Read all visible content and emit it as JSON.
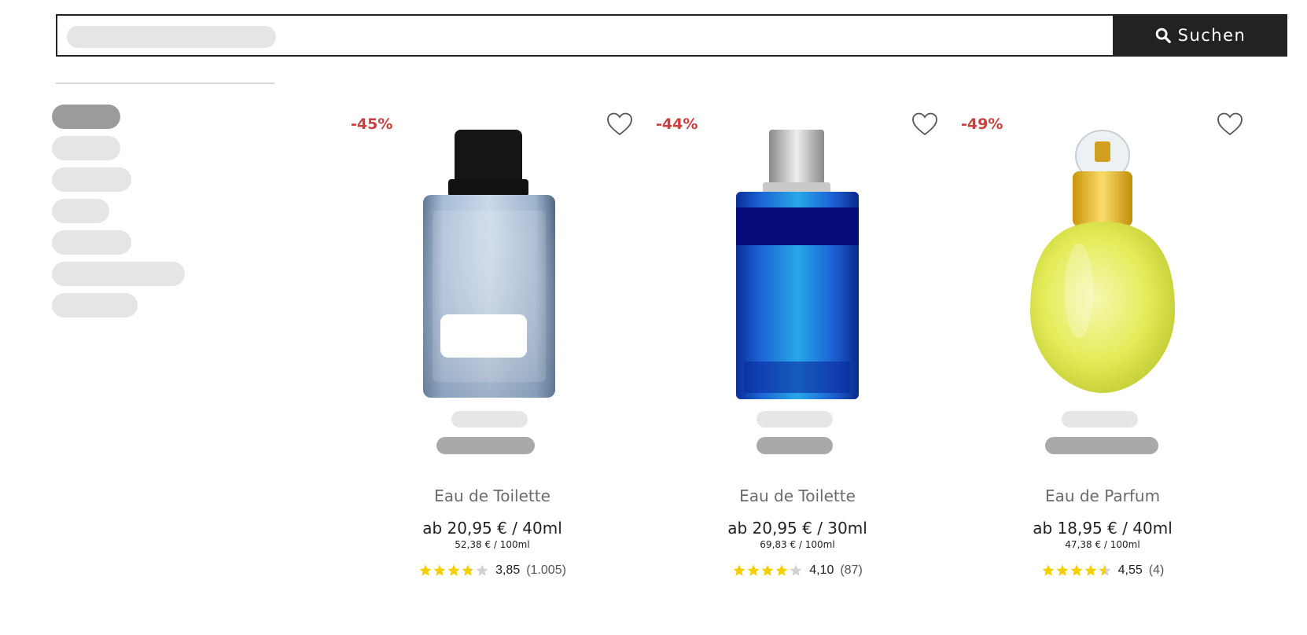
{
  "search": {
    "button_label": "Suchen",
    "button_icon": "search-icon"
  },
  "sidebar": {
    "items_count_visible": 7,
    "active_index": 0
  },
  "colors": {
    "accent_dark": "#222222",
    "discount_red": "#c9403f",
    "star_yellow": "#f5d000",
    "skeleton": "#e5e5e5",
    "skeleton_dark": "#a9a9a9"
  },
  "products": [
    {
      "discount": "-45%",
      "type": "Eau de Toilette",
      "price": "ab 20,95 € / 40ml",
      "unit_price": "52,38 € / 100ml",
      "rating": 3.85,
      "rating_label": "3,85",
      "reviews": "(1.005)",
      "icon": "heart-icon"
    },
    {
      "discount": "-44%",
      "type": "Eau de Toilette",
      "price": "ab 20,95 € / 30ml",
      "unit_price": "69,83 € / 100ml",
      "rating": 4.1,
      "rating_label": "4,10",
      "reviews": "(87)",
      "icon": "heart-icon"
    },
    {
      "discount": "-49%",
      "type": "Eau de Parfum",
      "price": "ab 18,95 € / 40ml",
      "unit_price": "47,38 € / 100ml",
      "rating": 4.55,
      "rating_label": "4,55",
      "reviews": "(4)",
      "icon": "heart-icon"
    }
  ]
}
